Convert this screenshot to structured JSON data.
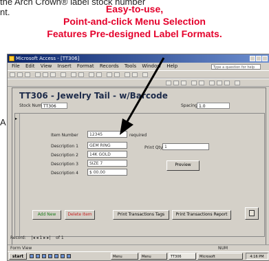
{
  "intro": {
    "line1": "the Arch Crown® label stock number",
    "line2": "nt.",
    "side_letter": "A"
  },
  "callout": {
    "line1": "Easy-to-use,",
    "line2": "Point-and-click Menu Selection",
    "line3": "Features Pre-designed Label Formats."
  },
  "window": {
    "title": "Microsoft Access - [TT306]",
    "menu": [
      "File",
      "Edit",
      "View",
      "Insert",
      "Format",
      "Records",
      "Tools",
      "Window",
      "Help"
    ],
    "help_placeholder": "Type a question for help"
  },
  "form": {
    "heading": "TT306 - Jewelry Tail - w/Barcode",
    "stock_label": "Stock Number",
    "stock_value": "TT306",
    "spacing_label": "Spacing",
    "spacing_value": "1.0",
    "record_selector": "▸",
    "fields": [
      {
        "label": "Item Number",
        "value": "12345",
        "note": "required"
      },
      {
        "label": "Description 1",
        "value": "GEM RING"
      },
      {
        "label": "Description 2",
        "value": "14K GOLD"
      },
      {
        "label": "Description 3",
        "value": "SIZE 7"
      },
      {
        "label": "Description 4",
        "value": "$ 00.00"
      }
    ],
    "print_qty_label": "Print Qty",
    "print_qty_value": "1",
    "preview_button": "Preview",
    "buttons": {
      "add": "Add New",
      "delete": "Delete Item",
      "print_tags": "Print Transactions Tags",
      "print_report": "Print Transactions Report",
      "close": "Close"
    }
  },
  "nav": {
    "record_label": "Record:",
    "controls": "|◂ ◂ 1 ▸ ▸|",
    "of_text": "of 1"
  },
  "status": {
    "left": "Form View",
    "right": "NUM"
  },
  "taskbar": {
    "start": "start",
    "tasks": [
      "Menu",
      "Menu",
      "TT306",
      "Microsoft"
    ],
    "clock": "4:16 PM"
  }
}
